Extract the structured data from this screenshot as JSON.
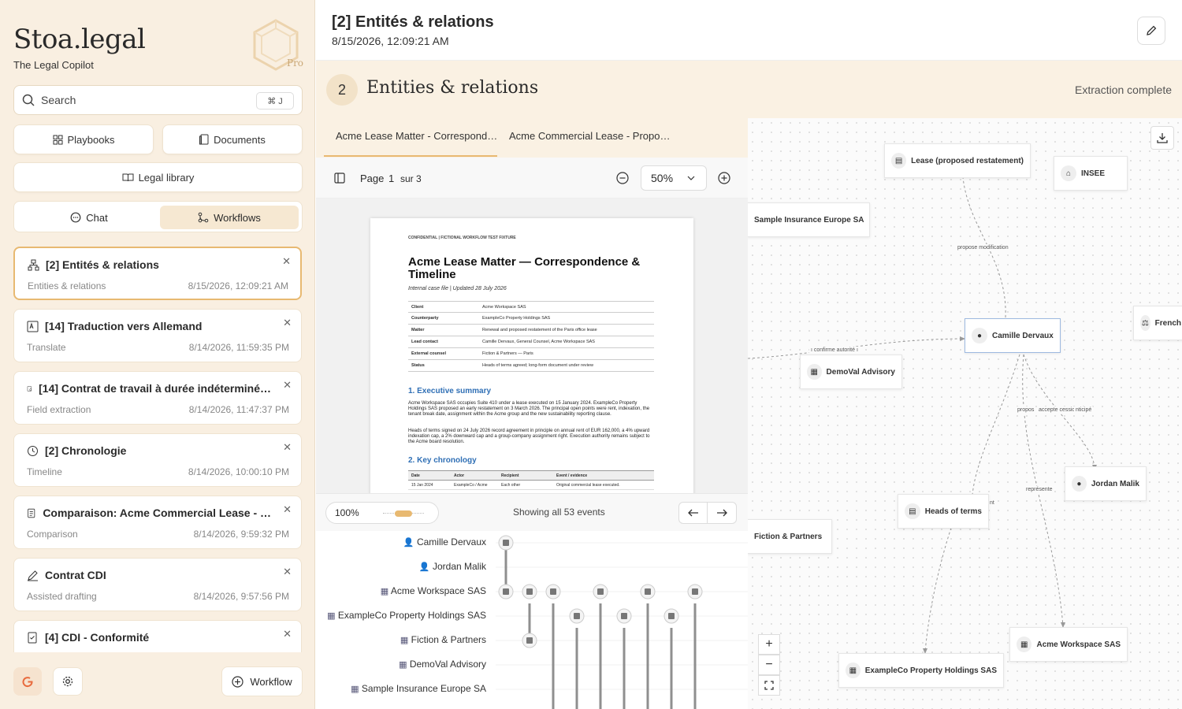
{
  "sidebar": {
    "brand": "Stoa.legal",
    "tagline": "The Legal Copilot",
    "pro_badge": "Pro",
    "search_label": "Search",
    "search_kbd": "⌘ J",
    "buttons": {
      "playbooks": "Playbooks",
      "documents": "Documents",
      "library": "Legal library"
    },
    "modes": {
      "chat": "Chat",
      "workflows": "Workflows"
    },
    "workflows": [
      {
        "title": "[2] Entités & relations",
        "type": "Entities & relations",
        "date": "8/15/2026, 12:09:21 AM",
        "icon": "hierarchy-icon"
      },
      {
        "title": "[14] Traduction vers Allemand",
        "type": "Translate",
        "date": "8/14/2026, 11:59:35 PM",
        "icon": "translate-icon"
      },
      {
        "title": "[14] Contrat de travail à durée indéterminé…",
        "type": "Field extraction",
        "date": "8/14/2026, 11:47:37 PM",
        "icon": "extract-icon"
      },
      {
        "title": "[2] Chronologie",
        "type": "Timeline",
        "date": "8/14/2026, 10:00:10 PM",
        "icon": "clock-icon"
      },
      {
        "title": "Comparaison: Acme Commercial Lease - …",
        "type": "Comparison",
        "date": "8/14/2026, 9:59:32 PM",
        "icon": "compare-icon"
      },
      {
        "title": "Contrat CDI",
        "type": "Assisted drafting",
        "date": "8/14/2026, 9:57:56 PM",
        "icon": "pen-icon"
      },
      {
        "title": "[4] CDI - Conformité",
        "type": "",
        "date": "",
        "icon": "checklist-icon"
      }
    ],
    "new_workflow": "Workflow"
  },
  "header": {
    "title": "[2] Entités & relations",
    "timestamp": "8/15/2026, 12:09:21 AM"
  },
  "step": {
    "number": "2",
    "title": "Entities & relations",
    "status": "Extraction complete"
  },
  "doc_tabs": [
    "Acme Lease Matter - Correspond…",
    "Acme Commercial Lease - Propo…"
  ],
  "viewer": {
    "page_label": "Page",
    "page": "1",
    "of_label": "sur 3",
    "zoom": "50%"
  },
  "document": {
    "header": "CONFIDENTIAL  |  FICTIONAL WORKFLOW TEST FIXTURE",
    "title": "Acme Lease Matter — Correspondence & Timeline",
    "subtitle": "Internal case file | Updated 28 July 2026",
    "table": [
      [
        "Client",
        "Acme Workspace SAS"
      ],
      [
        "Counterparty",
        "ExampleCo Property Holdings SAS"
      ],
      [
        "Matter",
        "Renewal and proposed restatement of the Paris office lease"
      ],
      [
        "Lead contact",
        "Camille Dervaux, General Counsel, Acme Workspace SAS"
      ],
      [
        "External counsel",
        "Fiction & Partners — Paris"
      ],
      [
        "Status",
        "Heads of terms agreed; long-form document under review"
      ]
    ],
    "section1": "1. Executive summary",
    "para1": "Acme Workspace SAS occupies Suite 410 under a lease executed on 15 January 2024. ExampleCo Property Holdings SAS proposed an early restatement on 3 March 2026. The principal open points were rent, indexation, the tenant break date, assignment within the Acme group and the new sustainability reporting clause.",
    "para2": "Heads of terms signed on 24 July 2026 record agreement in principle on annual rent of EUR 162,000, a 4% upward indexation cap, a 2% downward cap and a group-company assignment right. Execution authority remains subject to the Acme board resolution.",
    "section2": "2. Key chronology",
    "chron_headers": [
      "Date",
      "Actor",
      "Recipient",
      "Event / evidence"
    ],
    "chron_row": [
      "15 Jan 2024",
      "ExampleCo / Acme",
      "Each other",
      "Original commercial lease executed."
    ]
  },
  "timeline": {
    "zoom": "100%",
    "summary": "Showing all 53 events",
    "rows": [
      "Camille Dervaux",
      "Jordan Malik",
      "Acme Workspace SAS",
      "ExampleCo Property Holdings SAS",
      "Fiction & Partners",
      "DemoVal Advisory",
      "Sample Insurance Europe SA"
    ]
  },
  "graph": {
    "nodes": {
      "lease": "Lease (proposed restatement)",
      "insee": "INSEE",
      "sample": "Sample Insurance Europe SA",
      "french": "French",
      "camille": "Camille Dervaux",
      "demoval": "DemoVal Advisory",
      "jordan": "Jordan Malik",
      "heads": "Heads of terms",
      "fiction": "Fiction & Partners",
      "acme": "Acme Workspace SAS",
      "exampleco": "ExampleCo Property Holdings SAS"
    },
    "edges": {
      "propose_mod": "propose modification",
      "confirme": "ı confirme autorité ı",
      "propos": "propos",
      "accepte": "accepte cession",
      "anticipe": "nticipé",
      "represente": "représente",
      "nt": "nt"
    }
  }
}
